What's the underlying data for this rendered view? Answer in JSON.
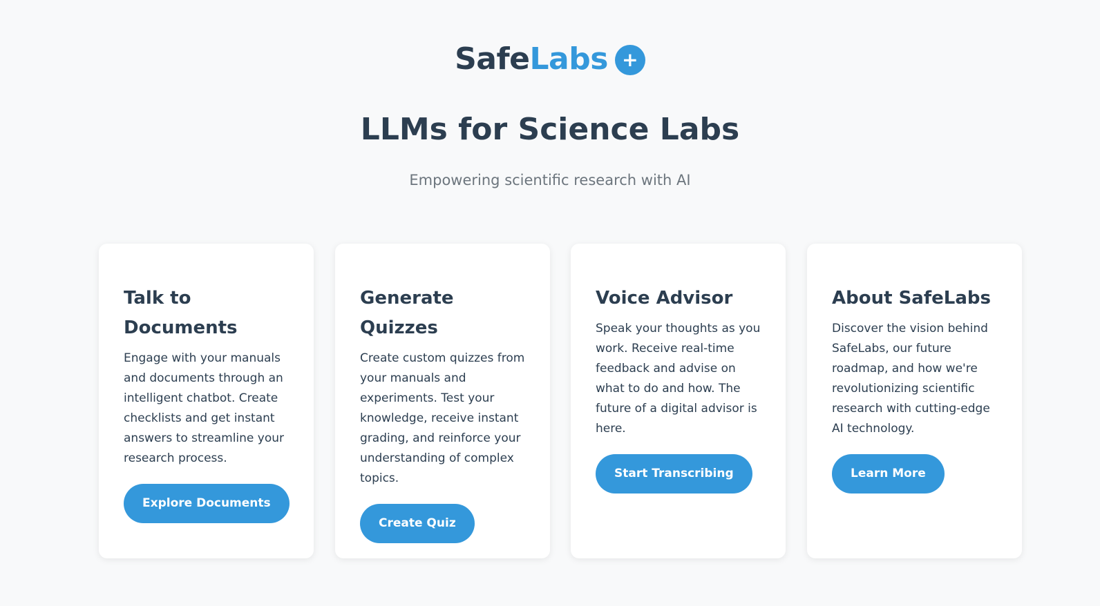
{
  "brand": {
    "name_part1": "Safe",
    "name_part2": "Labs",
    "plus_symbol": "+",
    "icon": "plus-icon",
    "dark_color": "#2c3e50",
    "accent_color": "#3498db"
  },
  "hero": {
    "title": "LLMs for Science Labs",
    "subtitle": "Empowering scientific research with AI"
  },
  "cards": [
    {
      "title": "Talk to Documents",
      "description": "Engage with your manuals and documents through an intelligent chatbot. Create checklists and get instant answers to streamline your research process.",
      "button_label": "Explore Documents"
    },
    {
      "title": "Generate Quizzes",
      "description": "Create custom quizzes from your manuals and experiments. Test your knowledge, receive instant grading, and reinforce your understanding of complex topics.",
      "button_label": "Create Quiz"
    },
    {
      "title": "Voice Advisor",
      "description": "Speak your thoughts as you work. Receive real-time feedback and advise on what to do and how. The future of a digital advisor is here.",
      "button_label": "Start Transcribing"
    },
    {
      "title": "About SafeLabs",
      "description": "Discover the vision behind SafeLabs, our future roadmap, and how we're revolutionizing scientific research with cutting-edge AI technology.",
      "button_label": "Learn More"
    }
  ]
}
